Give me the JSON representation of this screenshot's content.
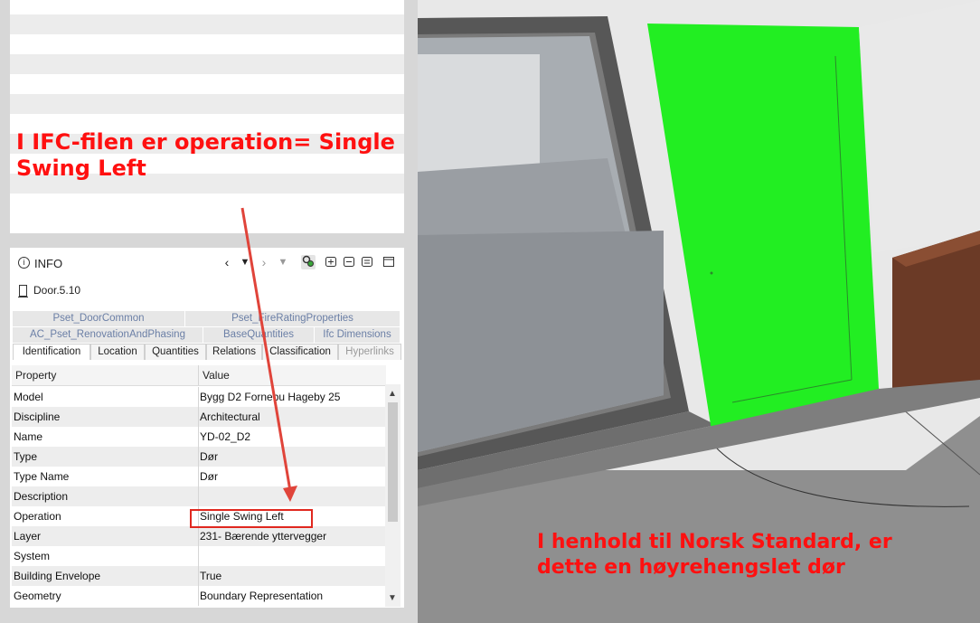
{
  "annotations": {
    "top": "I IFC-filen er operation= Single\nSwing Left",
    "bottom": "I henhold til Norsk Standard, er\ndette en høyrehengslet dør"
  },
  "info_panel": {
    "title": "INFO",
    "object_name": "Door.5.10",
    "pset_tabs_row1": [
      "Pset_DoorCommon",
      "Pset_FireRatingProperties"
    ],
    "pset_tabs_row2": [
      "AC_Pset_RenovationAndPhasing",
      "BaseQuantities",
      "Ifc Dimensions"
    ],
    "tabs": [
      "Identification",
      "Location",
      "Quantities",
      "Relations",
      "Classification",
      "Hyperlinks"
    ],
    "columns": {
      "property": "Property",
      "value": "Value"
    },
    "rows": [
      {
        "property": "Model",
        "value": "Bygg D2 Fornebu Hageby 25"
      },
      {
        "property": "Discipline",
        "value": "Architectural"
      },
      {
        "property": "Name",
        "value": "YD-02_D2"
      },
      {
        "property": "Type",
        "value": "Dør"
      },
      {
        "property": "Type Name",
        "value": "Dør"
      },
      {
        "property": "Description",
        "value": ""
      },
      {
        "property": "Operation",
        "value": "Single Swing Left"
      },
      {
        "property": "Layer",
        "value": "231- Bærende yttervegger"
      },
      {
        "property": "System",
        "value": ""
      },
      {
        "property": "Building Envelope",
        "value": "True"
      },
      {
        "property": "Geometry",
        "value": "Boundary Representation"
      }
    ]
  },
  "colors": {
    "annotation": "#ff1010",
    "selected_door": "#22ee22",
    "highlight_box": "#e0281f",
    "arrow": "#e0443a"
  }
}
